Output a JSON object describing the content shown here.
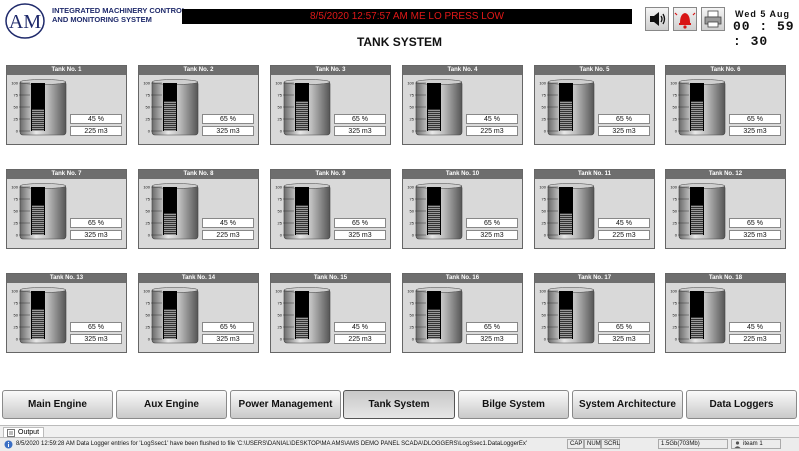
{
  "header": {
    "brand_line1": "INTEGRATED MACHINERY CONTROL",
    "brand_line2": "AND MONITORING SYSTEM",
    "logo_text": "AM",
    "alarm_message": "8/5/2020 12:57:57 AM ME LO PRESS LOW",
    "clock_date": "Wed  5  Aug",
    "clock_time": "00 : 59 : 30",
    "icons": [
      "speaker-icon",
      "alarm-bell-icon",
      "printer-icon"
    ]
  },
  "page_title": "TANK SYSTEM",
  "gauge_ticks": [
    "100",
    "75",
    "50",
    "25",
    "0"
  ],
  "tanks": [
    {
      "label": "Tank No. 1",
      "percent": "45 %",
      "volume": "225 m3",
      "level": 45
    },
    {
      "label": "Tank No. 2",
      "percent": "65 %",
      "volume": "325 m3",
      "level": 65
    },
    {
      "label": "Tank No. 3",
      "percent": "65 %",
      "volume": "325 m3",
      "level": 65
    },
    {
      "label": "Tank No. 4",
      "percent": "45 %",
      "volume": "225 m3",
      "level": 45
    },
    {
      "label": "Tank No. 5",
      "percent": "65 %",
      "volume": "325 m3",
      "level": 65
    },
    {
      "label": "Tank No. 6",
      "percent": "65 %",
      "volume": "325 m3",
      "level": 65
    },
    {
      "label": "Tank No. 7",
      "percent": "65 %",
      "volume": "325 m3",
      "level": 65
    },
    {
      "label": "Tank No. 8",
      "percent": "45 %",
      "volume": "225 m3",
      "level": 45
    },
    {
      "label": "Tank No. 9",
      "percent": "65 %",
      "volume": "325 m3",
      "level": 65
    },
    {
      "label": "Tank No. 10",
      "percent": "65 %",
      "volume": "325 m3",
      "level": 65
    },
    {
      "label": "Tank No. 11",
      "percent": "45 %",
      "volume": "225 m3",
      "level": 45
    },
    {
      "label": "Tank No. 12",
      "percent": "65 %",
      "volume": "325 m3",
      "level": 65
    },
    {
      "label": "Tank No. 13",
      "percent": "65 %",
      "volume": "325 m3",
      "level": 65
    },
    {
      "label": "Tank No. 14",
      "percent": "65 %",
      "volume": "325 m3",
      "level": 65
    },
    {
      "label": "Tank No. 15",
      "percent": "45 %",
      "volume": "225 m3",
      "level": 45
    },
    {
      "label": "Tank No. 16",
      "percent": "65 %",
      "volume": "325 m3",
      "level": 65
    },
    {
      "label": "Tank No. 17",
      "percent": "65 %",
      "volume": "325 m3",
      "level": 65
    },
    {
      "label": "Tank No. 18",
      "percent": "45 %",
      "volume": "225 m3",
      "level": 45
    }
  ],
  "nav": {
    "buttons": [
      "Main Engine",
      "Aux Engine",
      "Power Management",
      "Tank System",
      "Bilge System",
      "System Architecture",
      "Data Loggers"
    ],
    "active": "Tank System"
  },
  "output": {
    "tab_label": "Output"
  },
  "status": {
    "message": "8/5/2020 12:59:28 AM Data Logger entries for 'LogSsec1' have been flushed to file 'C:\\USERS\\DANIAL\\DESKTOP\\MA AMS\\AMS DEMO PANEL SCADA\\DLOGGERS\\LogSsec1.DataLoggerEx'",
    "cap": "CAP",
    "num": "NUM",
    "scrl": "SCRL",
    "memory": "1.5Gb(703Mb)",
    "items": "iteam 1"
  },
  "colors": {
    "alarm_text": "#e01818",
    "alarm_bg": "#000000",
    "tank_title_bg": "#6e6e6e",
    "panel_bg": "#d9d9d9",
    "brand_text": "#1f2a6b"
  }
}
